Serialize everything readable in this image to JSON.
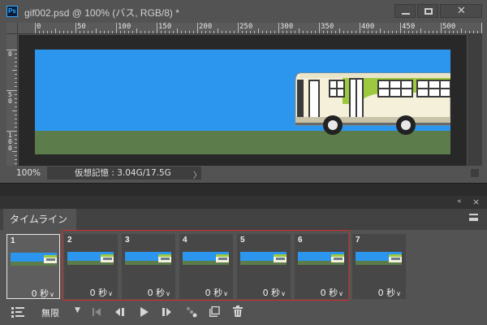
{
  "window": {
    "title": "gif002.psd @ 100% (バス, RGB/8) *",
    "app_icon": "Ps",
    "minimize_icon": "minimize-icon",
    "maximize_icon": "maximize-icon",
    "close_icon": "close-icon"
  },
  "rulers": {
    "horizontal_labels": [
      "0",
      "50",
      "100",
      "150",
      "200",
      "250",
      "300",
      "350",
      "400",
      "450",
      "500"
    ],
    "vertical_labels": [
      "0",
      "50",
      "100"
    ]
  },
  "status": {
    "zoom": "100%",
    "virtual_memory": "仮想記憶 : 3.04G/17.5G",
    "expand_arrow": "〉"
  },
  "panel": {
    "tab_label": "タイムライン",
    "collapse_glyph": "«",
    "close_glyph": "×"
  },
  "frames": [
    {
      "number": "1",
      "delay": "0 秒",
      "selected": true
    },
    {
      "number": "2",
      "delay": "0 秒",
      "selected": false
    },
    {
      "number": "3",
      "delay": "0 秒",
      "selected": false
    },
    {
      "number": "4",
      "delay": "0 秒",
      "selected": false
    },
    {
      "number": "5",
      "delay": "0 秒",
      "selected": false
    },
    {
      "number": "6",
      "delay": "0 秒",
      "selected": false
    },
    {
      "number": "7",
      "delay": "0 秒",
      "selected": false
    }
  ],
  "toolbar": {
    "loop_label": "無限",
    "convert_icon": "convert-to-video-timeline-icon",
    "loop_dropdown_icon": "chevron-down-icon",
    "first_frame_icon": "first-frame-icon",
    "prev_frame_icon": "previous-frame-icon",
    "play_icon": "play-icon",
    "next_frame_icon": "next-frame-icon",
    "tween_icon": "tween-icon",
    "duplicate_icon": "duplicate-frame-icon",
    "delete_icon": "trash-icon"
  },
  "colors": {
    "sky": "#2c96ee",
    "grass": "#5d7c4b",
    "bus_body": "#f4f0da",
    "bus_accent": "#9cc93f",
    "selection_outline": "#d92a2a"
  }
}
